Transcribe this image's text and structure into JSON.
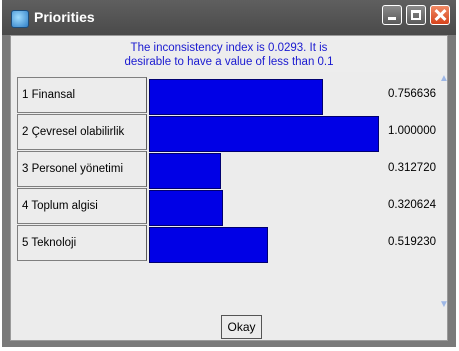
{
  "window": {
    "title": "Priorities"
  },
  "info": {
    "line1": "The inconsistency index is 0.0293.  It is",
    "line2": "desirable to have a value of less than 0.1",
    "color": "#1a1ad0"
  },
  "priorities": [
    {
      "label": "1 Finansal",
      "value_text": "0.756636",
      "value": 0.756636
    },
    {
      "label": "2 Çevresel olabilirlik",
      "value_text": "1.000000",
      "value": 1.0
    },
    {
      "label": "3 Personel yönetimi",
      "value_text": "0.312720",
      "value": 0.31272
    },
    {
      "label": "4 Toplum algisi",
      "value_text": "0.320624",
      "value": 0.320624
    },
    {
      "label": "5 Teknoloji",
      "value_text": "0.519230",
      "value": 0.51923
    }
  ],
  "bar_color": "#0000e6",
  "buttons": {
    "okay": "Okay"
  },
  "icons": {
    "app": "app-icon",
    "minimize": "minimize-icon",
    "maximize": "maximize-icon",
    "close": "close-icon"
  }
}
